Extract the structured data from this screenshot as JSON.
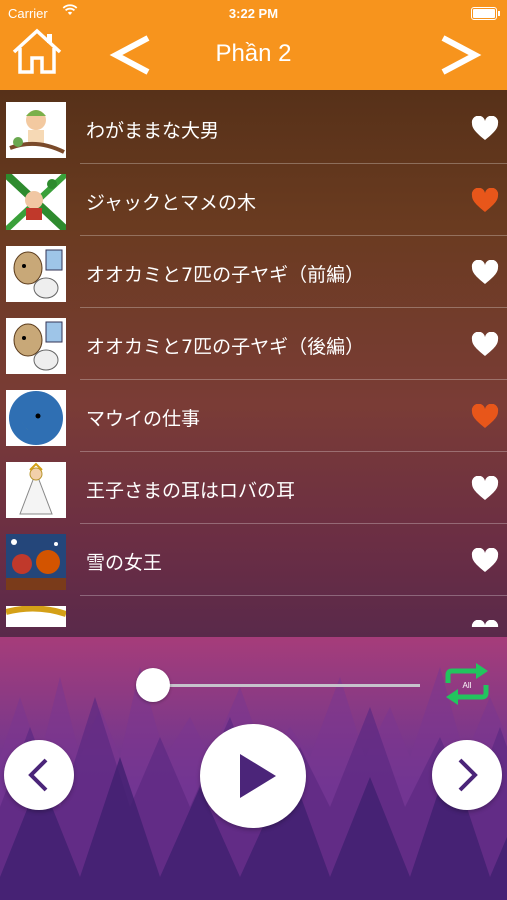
{
  "status_bar": {
    "carrier": "Carrier",
    "time": "3:22 PM"
  },
  "header": {
    "title": "Phần 2"
  },
  "colors": {
    "accent": "#f7941d",
    "favorite": "#e8561a",
    "heart_default": "#ffffff",
    "repeat": "#22c55e"
  },
  "stories": [
    {
      "label": "わがままな大男",
      "favorite": false
    },
    {
      "label": "ジャックとマメの木",
      "favorite": true
    },
    {
      "label": "オオカミと7匹の子ヤギ（前編）",
      "favorite": false
    },
    {
      "label": "オオカミと7匹の子ヤギ（後編）",
      "favorite": false
    },
    {
      "label": "マウイの仕事",
      "favorite": true
    },
    {
      "label": "王子さまの耳はロバの耳",
      "favorite": false
    },
    {
      "label": "雪の女王",
      "favorite": false
    },
    {
      "label": "",
      "favorite": false
    }
  ],
  "player": {
    "progress": 0.0,
    "repeat_label": "All"
  }
}
